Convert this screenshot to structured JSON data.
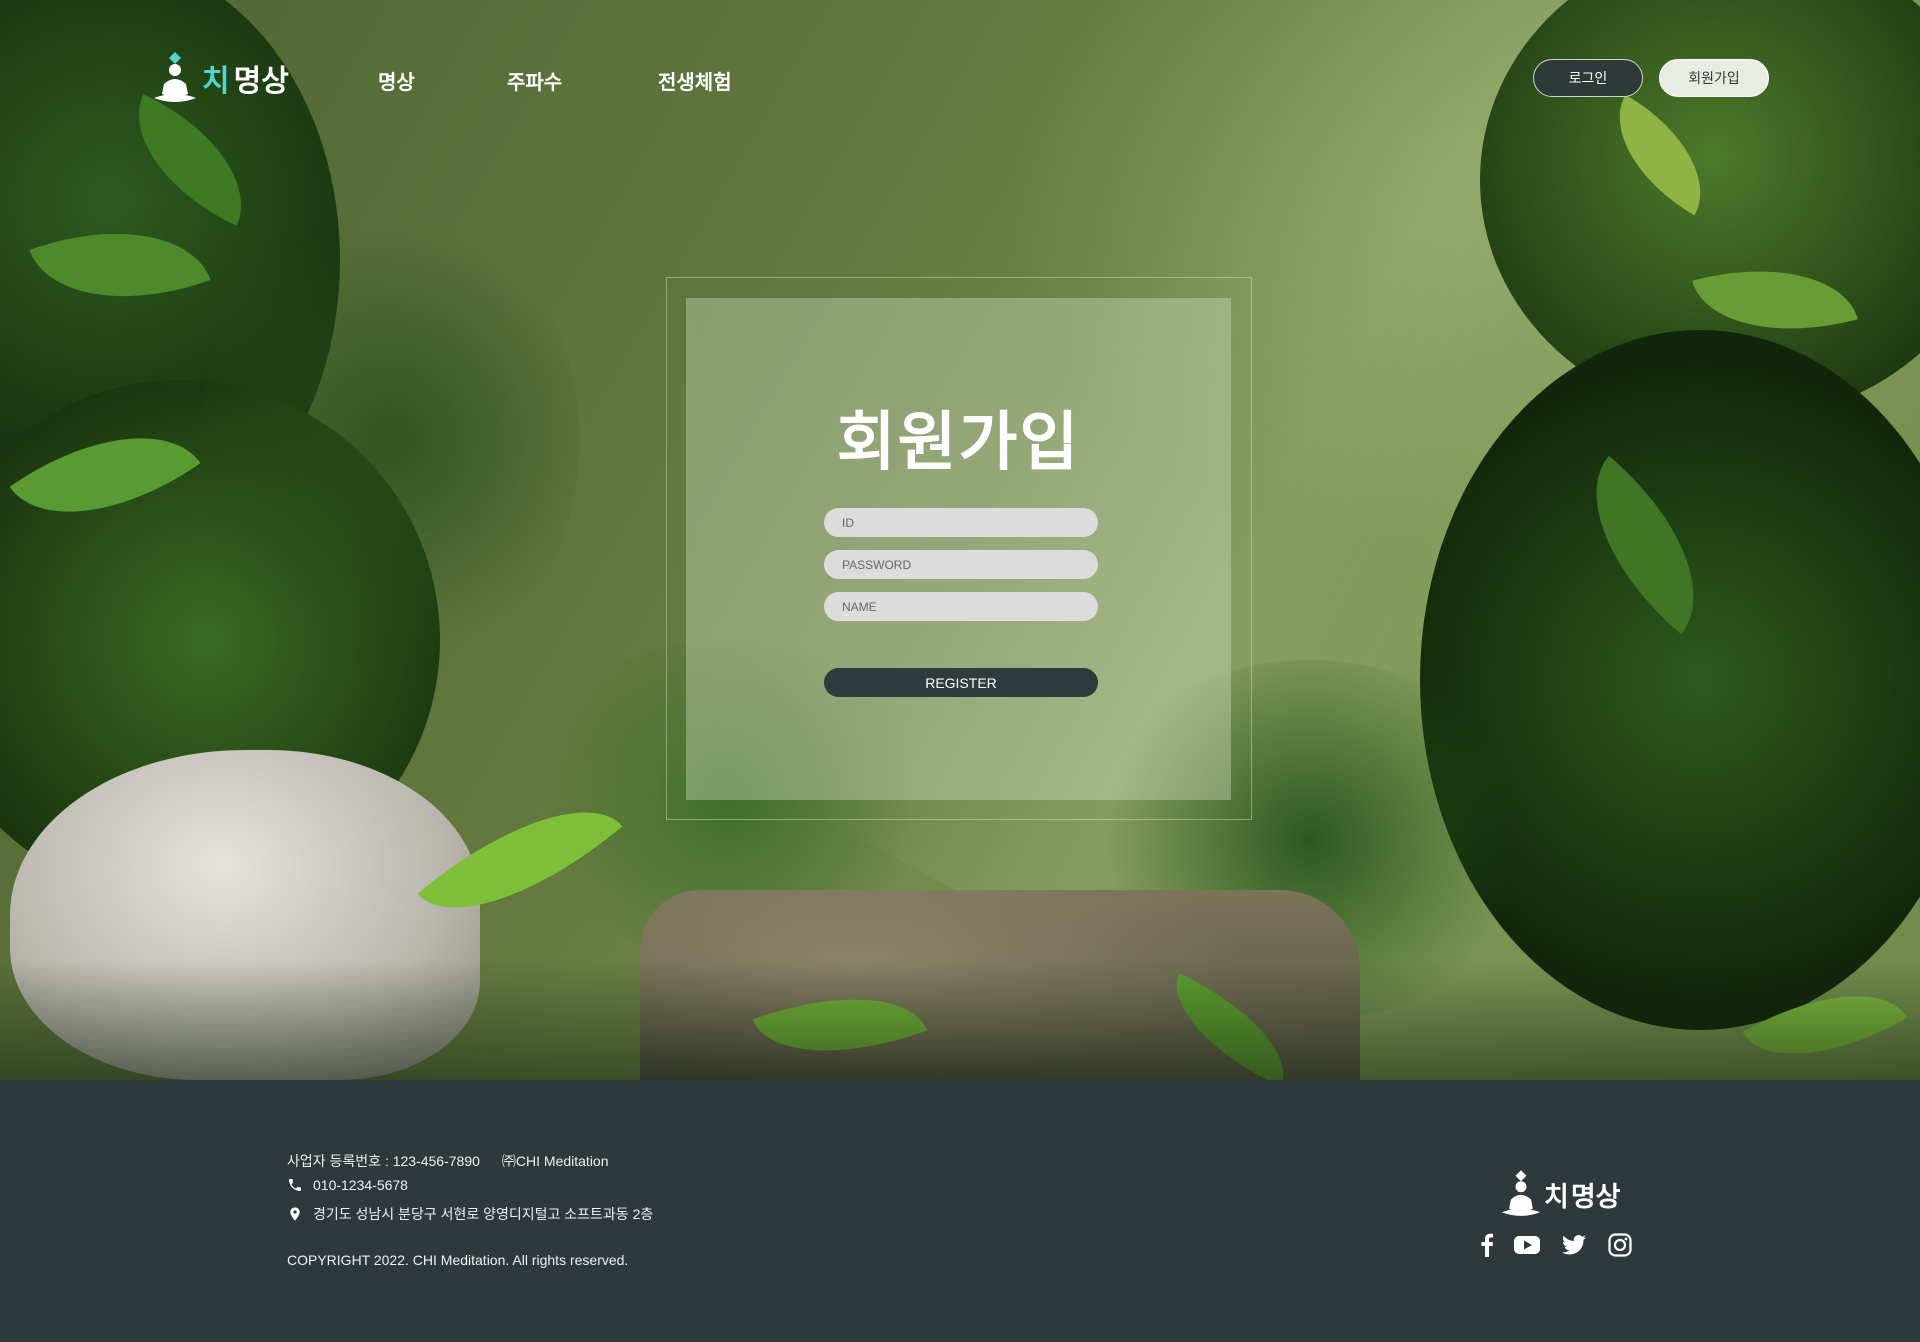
{
  "header": {
    "logo_prefix": "치",
    "logo_suffix": "명상",
    "nav": [
      "명상",
      "주파수",
      "전생체험"
    ],
    "login_label": "로그인",
    "signup_label": "회원가입"
  },
  "signup_card": {
    "title": "회원가입",
    "id_placeholder": "ID",
    "password_placeholder": "PASSWORD",
    "name_placeholder": "NAME",
    "register_label": "REGISTER"
  },
  "footer": {
    "business_number": "사업자 등록번호 : 123-456-7890",
    "company": "㈜CHI Meditation",
    "phone": "010-1234-5678",
    "address": "경기도 성남시 분당구 서현로 양영디지털고 소프트과동 2층",
    "copyright": "COPYRIGHT 2022. CHI Meditation. All rights reserved.",
    "logo_prefix": "치",
    "logo_suffix": "명상",
    "social_icons": [
      "facebook-icon",
      "youtube-icon",
      "twitter-icon",
      "instagram-icon"
    ]
  },
  "colors": {
    "accent": "#4fd6d0",
    "footer_bg": "#2f383b",
    "button_dark": "#303b3d"
  }
}
